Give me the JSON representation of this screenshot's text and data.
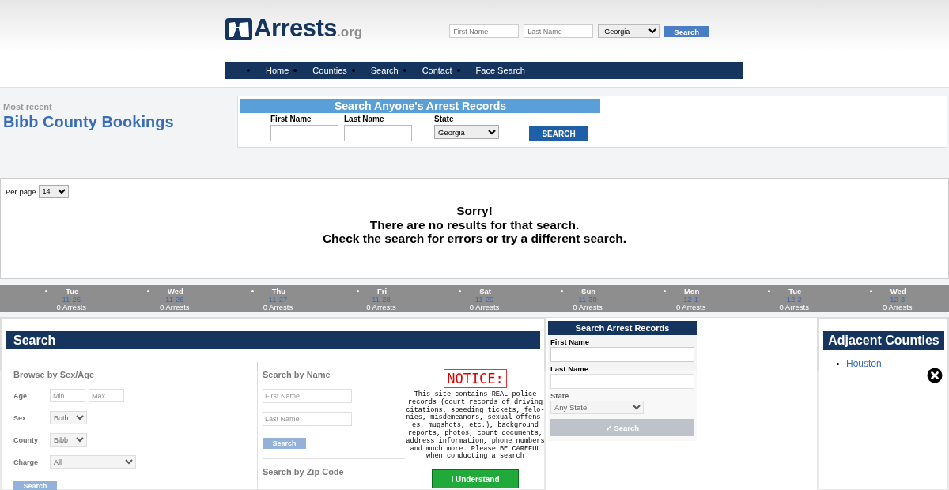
{
  "header": {
    "logo": {
      "name": "Arrests",
      "suffix": ".org"
    },
    "quick_search": {
      "fields": [
        {
          "kind": "text",
          "placeholder": "First Name"
        },
        {
          "kind": "text",
          "placeholder": "Last Name"
        },
        {
          "kind": "select",
          "value": "Georgia"
        }
      ],
      "button": "Search"
    }
  },
  "nav": [
    {
      "label": "Home"
    },
    {
      "label": "Counties"
    },
    {
      "label": "Search"
    },
    {
      "label": "Contact"
    },
    {
      "label": "Face Search"
    }
  ],
  "heading": {
    "kicker": "Most recent",
    "title": "Bibb County Bookings"
  },
  "search_panel": {
    "title": "Search Anyone's Arrest Records",
    "fields": [
      {
        "kind": "text",
        "label": "First Name"
      },
      {
        "kind": "text",
        "label": "Last Name"
      },
      {
        "kind": "select",
        "label": "State",
        "value": "Georgia"
      }
    ],
    "button": "SEARCH"
  },
  "results": {
    "per_page": {
      "label": "Per page",
      "value": "14"
    },
    "message": [
      "Sorry!",
      "There are no results for that search.",
      "Check the search for errors or try a different search."
    ]
  },
  "days": [
    {
      "weekday": "Tue",
      "date": "11-25",
      "count": "0 Arrests"
    },
    {
      "weekday": "Wed",
      "date": "11-26",
      "count": "0 Arrests"
    },
    {
      "weekday": "Thu",
      "date": "11-27",
      "count": "0 Arrests"
    },
    {
      "weekday": "Fri",
      "date": "11-28",
      "count": "0 Arrests"
    },
    {
      "weekday": "Sat",
      "date": "11-29",
      "count": "0 Arrests"
    },
    {
      "weekday": "Sun",
      "date": "11-30",
      "count": "0 Arrests"
    },
    {
      "weekday": "Mon",
      "date": "12-1",
      "count": "0 Arrests"
    },
    {
      "weekday": "Tue",
      "date": "12-2",
      "count": "0 Arrests"
    },
    {
      "weekday": "Wed",
      "date": "12-3",
      "count": "0 Arrests"
    }
  ],
  "search_section": {
    "title": "Search",
    "browse": {
      "title": "Browse by Sex/Age",
      "rows": [
        {
          "kind": "range",
          "label": "Age",
          "placeholders": [
            "Min",
            "Max"
          ]
        },
        {
          "kind": "select",
          "label": "Sex",
          "value": "Both"
        },
        {
          "kind": "select",
          "label": "County",
          "value": "Bibb"
        },
        {
          "kind": "wide-select",
          "label": "Charge",
          "value": "All"
        }
      ],
      "button": "Search"
    },
    "by_name": {
      "title": "Search by Name",
      "placeholders": [
        "First Name",
        "Last Name"
      ],
      "button": "Search"
    },
    "by_zip": {
      "title": "Search by Zip Code"
    }
  },
  "arrest_records": {
    "title": "Search Arrest Records",
    "fields": [
      {
        "kind": "text",
        "label": "First Name"
      },
      {
        "kind": "text",
        "label": "Last Name"
      },
      {
        "kind": "select",
        "label": "State",
        "value": "Any State"
      }
    ],
    "button": "✓ Search"
  },
  "adjacent": {
    "title": "Adjacent Counties",
    "items": [
      "Houston"
    ]
  },
  "notice": {
    "title": "NOTICE:",
    "text": "This site contains REAL police\nrecords (court records of driving\ncitations, speeding tickets, felo-\nnies, misdemeanors, sexual offens-\nes, mugshots, etc.), background\nreports, photos, court documents,\naddress information, phone numbers\nand much more. Please BE CAREFUL\nwhen conducting a search",
    "button": "I Understand"
  }
}
